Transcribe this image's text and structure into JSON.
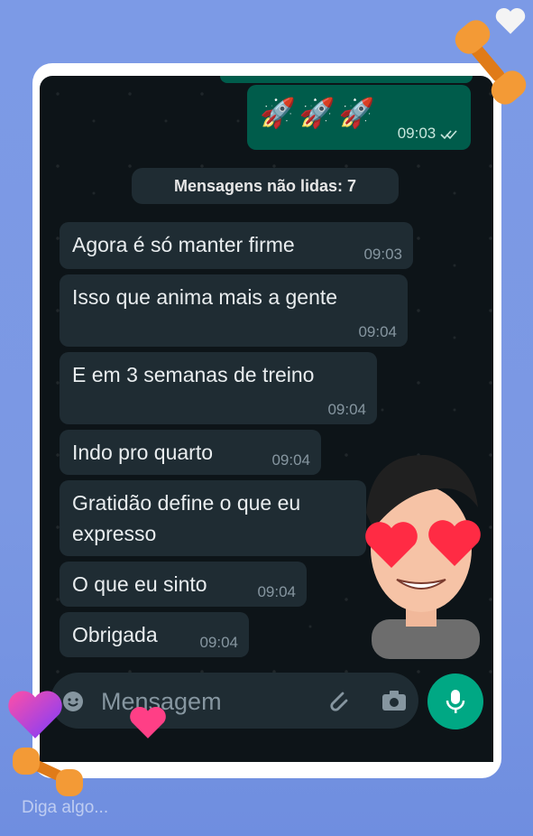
{
  "outgoing": {
    "emoji": "🚀🚀🚀",
    "time": "09:03",
    "status_icon": "double-check-icon"
  },
  "unread_label": "Mensagens não lidas: 7",
  "messages": [
    {
      "text": "Agora é só manter firme",
      "time": "09:03"
    },
    {
      "text": "Isso que anima mais a gente",
      "time": "09:04"
    },
    {
      "text": "E em 3 semanas de treino",
      "time": "09:04"
    },
    {
      "text": "Indo pro quarto",
      "time": "09:04"
    },
    {
      "text": "Gratidão define o que eu",
      "text2": "expresso"
    },
    {
      "text": "O que eu sinto",
      "time": "09:04"
    },
    {
      "text": "Obrigada",
      "time": "09:04"
    }
  ],
  "composer": {
    "placeholder": "Mensagem",
    "icons": [
      "emoji-icon",
      "attach-icon",
      "camera-icon",
      "mic-icon"
    ]
  },
  "story": {
    "caption": "Diga algo..."
  },
  "colors": {
    "bg": "#7b98e3",
    "chat": "#0d1418",
    "bubble_in": "#1f2c33",
    "bubble_out": "#005c4b",
    "accent": "#00a884"
  }
}
